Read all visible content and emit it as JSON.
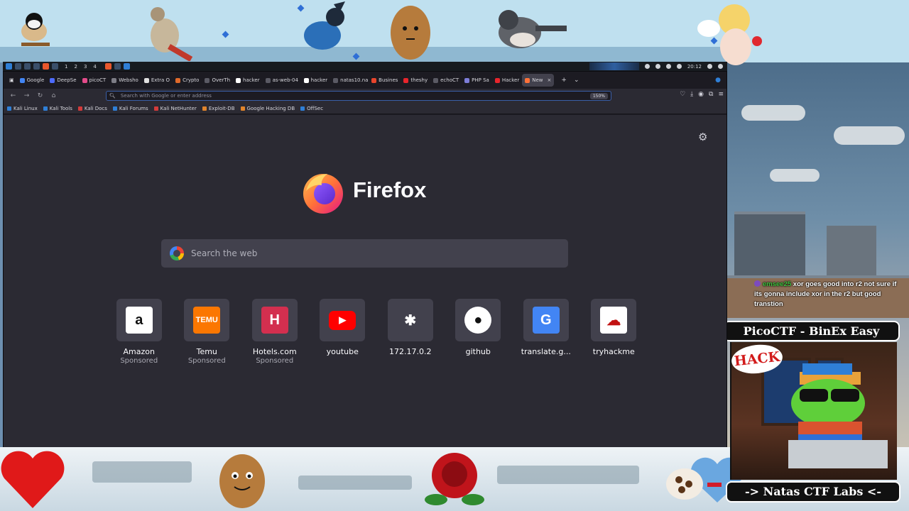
{
  "overlay": {
    "chat": {
      "username": "emsee25",
      "message": "xor goes good into r2 not sure if its gonna include xor in the r2 but good transtion"
    },
    "banner_top": "PicoCTF - BinEx Easy",
    "banner_bottom": "-> Natas CTF Labs <-",
    "hack_text": "HACK"
  },
  "kali_panel": {
    "workspaces": [
      "1",
      "2",
      "3",
      "4"
    ],
    "clock": "20:12"
  },
  "browser": {
    "tabs": [
      {
        "label": "Google",
        "color": "#4285f4"
      },
      {
        "label": "DeepSe",
        "color": "#4d6bfe"
      },
      {
        "label": "picoCT",
        "color": "#e34b8a"
      },
      {
        "label": "Websho",
        "color": "#7d7d86"
      },
      {
        "label": "Extra O",
        "color": "#e0e0e0"
      },
      {
        "label": "Crypto",
        "color": "#e06a2b"
      },
      {
        "label": "OverTh",
        "color": "#5a5a64"
      },
      {
        "label": "hacker",
        "color": "#ffffff"
      },
      {
        "label": "as-web-04",
        "color": "#5a5a64"
      },
      {
        "label": "hacker",
        "color": "#ffffff"
      },
      {
        "label": "natas10.na",
        "color": "#5a5a64"
      },
      {
        "label": "Busines",
        "color": "#e8452c"
      },
      {
        "label": "theshy",
        "color": "#e8252c"
      },
      {
        "label": "echoCT",
        "color": "#5a5a64"
      },
      {
        "label": "PHP Sa",
        "color": "#7d7dd8"
      },
      {
        "label": "Hacker",
        "color": "#e8252c"
      },
      {
        "label": "New",
        "color": "#ff7139",
        "active": true
      }
    ],
    "url_placeholder": "Search with Google or enter address",
    "zoom": "150%",
    "bookmarks": [
      {
        "label": "Kali Linux",
        "color": "#2f7fd6"
      },
      {
        "label": "Kali Tools",
        "color": "#2f7fd6"
      },
      {
        "label": "Kali Docs",
        "color": "#d23b3b"
      },
      {
        "label": "Kali Forums",
        "color": "#2f7fd6"
      },
      {
        "label": "Kali NetHunter",
        "color": "#d23b3b"
      },
      {
        "label": "Exploit-DB",
        "color": "#e0842b"
      },
      {
        "label": "Google Hacking DB",
        "color": "#e0842b"
      },
      {
        "label": "OffSec",
        "color": "#2f7fd6"
      }
    ],
    "newtab": {
      "brand": "Firefox",
      "search_placeholder": "Search the web",
      "tiles": [
        {
          "label": "Amazon",
          "sub": "Sponsored",
          "icon": "amazon-icon",
          "bg": "#ffffff",
          "fg": "#111111",
          "glyph": "a"
        },
        {
          "label": "Temu",
          "sub": "Sponsored",
          "icon": "temu-icon",
          "bg": "#fb7701",
          "fg": "#ffffff",
          "glyph": "TEMU"
        },
        {
          "label": "Hotels.com",
          "sub": "Sponsored",
          "icon": "hotels-icon",
          "bg": "#d32f4f",
          "fg": "#ffffff",
          "glyph": "H"
        },
        {
          "label": "youtube",
          "sub": "",
          "icon": "youtube-icon",
          "bg": "#42414d",
          "fg": "#ffffff",
          "glyph": "▶"
        },
        {
          "label": "172.17.0.2",
          "sub": "",
          "icon": "joomla-icon",
          "bg": "#42414d",
          "fg": "#ffffff",
          "glyph": "✱"
        },
        {
          "label": "github",
          "sub": "",
          "icon": "github-icon",
          "bg": "#ffffff",
          "fg": "#111111",
          "glyph": "●"
        },
        {
          "label": "translate.g...",
          "sub": "",
          "icon": "google-translate-icon",
          "bg": "#4285f4",
          "fg": "#ffffff",
          "glyph": "G"
        },
        {
          "label": "tryhackme",
          "sub": "",
          "icon": "tryhackme-icon",
          "bg": "#ffffff",
          "fg": "#c11111",
          "glyph": "☁"
        }
      ]
    }
  }
}
